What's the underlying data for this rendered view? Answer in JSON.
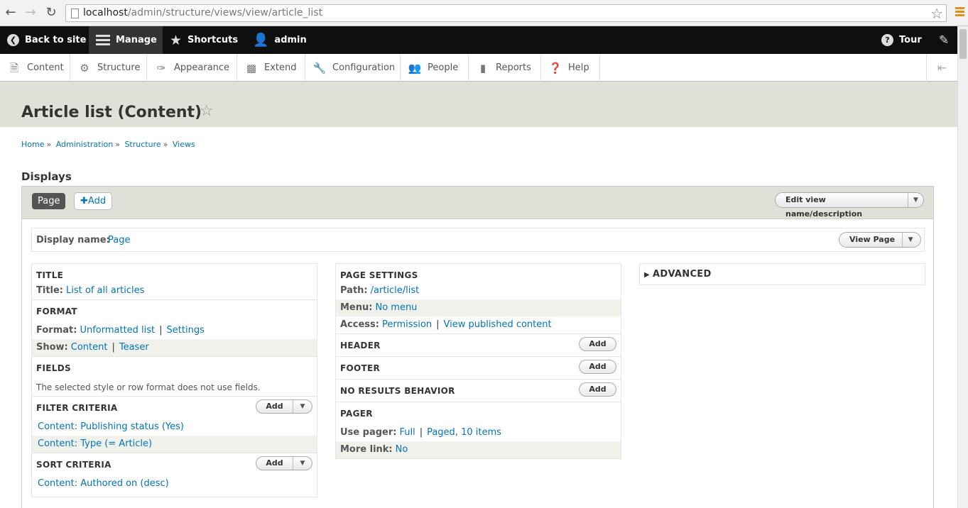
{
  "browser": {
    "url_host": "localhost",
    "url_path": "/admin/structure/views/view/article_list"
  },
  "toolbar": {
    "back": "Back to site",
    "manage": "Manage",
    "shortcuts": "Shortcuts",
    "user": "admin",
    "tour": "Tour"
  },
  "tray": {
    "items": [
      "Content",
      "Structure",
      "Appearance",
      "Extend",
      "Configuration",
      "People",
      "Reports",
      "Help"
    ]
  },
  "page": {
    "title": "Article list (Content)"
  },
  "breadcrumb": [
    "Home",
    "Administration",
    "Structure",
    "Views"
  ],
  "displays": {
    "heading": "Displays",
    "active_tab": "Page",
    "add_label": "Add",
    "edit_view_label": "Edit view name/description",
    "display_name_key": "Display name:",
    "display_name_value": "Page",
    "view_page_label": "View Page"
  },
  "columns": {
    "title": {
      "header": "TITLE",
      "title_key": "Title:",
      "title_value": "List of all articles"
    },
    "format": {
      "header": "FORMAT",
      "format_key": "Format:",
      "format_value": "Unformatted list",
      "format_settings": "Settings",
      "show_key": "Show:",
      "show_value": "Content",
      "show_mode": "Teaser"
    },
    "fields": {
      "header": "FIELDS",
      "note": "The selected style or row format does not use fields."
    },
    "filter": {
      "header": "FILTER CRITERIA",
      "add": "Add",
      "items": [
        "Content: Publishing status (Yes)",
        "Content: Type (= Article)"
      ]
    },
    "sort": {
      "header": "SORT CRITERIA",
      "add": "Add",
      "items": [
        "Content: Authored on (desc)"
      ]
    },
    "page_settings": {
      "header": "PAGE SETTINGS",
      "path_key": "Path:",
      "path_value": "/article/list",
      "menu_key": "Menu:",
      "menu_value": "No menu",
      "access_key": "Access:",
      "access_value": "Permission",
      "access_detail": "View published content"
    },
    "header": {
      "header": "HEADER",
      "add": "Add"
    },
    "footer": {
      "header": "FOOTER",
      "add": "Add"
    },
    "no_results": {
      "header": "NO RESULTS BEHAVIOR",
      "add": "Add"
    },
    "pager": {
      "header": "PAGER",
      "use_key": "Use pager:",
      "use_value": "Full",
      "use_detail": "Paged, 10 items",
      "more_key": "More link:",
      "more_value": "No"
    },
    "advanced": {
      "header": "ADVANCED"
    }
  }
}
